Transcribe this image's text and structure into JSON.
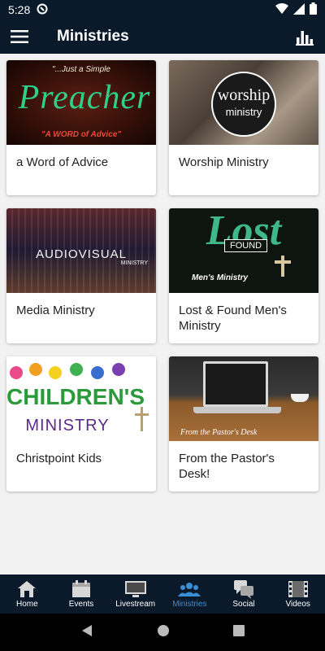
{
  "status": {
    "time": "5:28"
  },
  "header": {
    "title": "Ministries"
  },
  "cards": [
    {
      "label": "a Word of Advice",
      "thumb": {
        "line1": "\"...Just a Simple",
        "big": "Preacher",
        "line2": "\"A WORD of Advice\""
      }
    },
    {
      "label": "Worship Ministry",
      "thumb": {
        "big": "worship",
        "small": "ministry"
      }
    },
    {
      "label": "Media Ministry",
      "thumb": {
        "big": "AUDIOVISUAL",
        "small": "MINISTRY"
      }
    },
    {
      "label": "Lost & Found Men's Ministry",
      "thumb": {
        "big": "Lost",
        "badge": "FOUND",
        "small": "Men's Ministry"
      }
    },
    {
      "label": "Christpoint Kids",
      "thumb": {
        "big": "CHILDREN'S",
        "small": "MINISTRY"
      }
    },
    {
      "label": "From the Pastor's Desk!",
      "thumb": {
        "small": "From the Pastor's Desk"
      }
    }
  ],
  "nav": [
    {
      "label": "Home",
      "icon": "home-icon"
    },
    {
      "label": "Events",
      "icon": "calendar-icon"
    },
    {
      "label": "Livestream",
      "icon": "monitor-icon"
    },
    {
      "label": "Ministries",
      "icon": "people-icon"
    },
    {
      "label": "Social",
      "icon": "chat-icon"
    },
    {
      "label": "Videos",
      "icon": "film-icon"
    }
  ],
  "colors": {
    "appbar": "#0b1a2b",
    "active": "#3a8fd9"
  }
}
